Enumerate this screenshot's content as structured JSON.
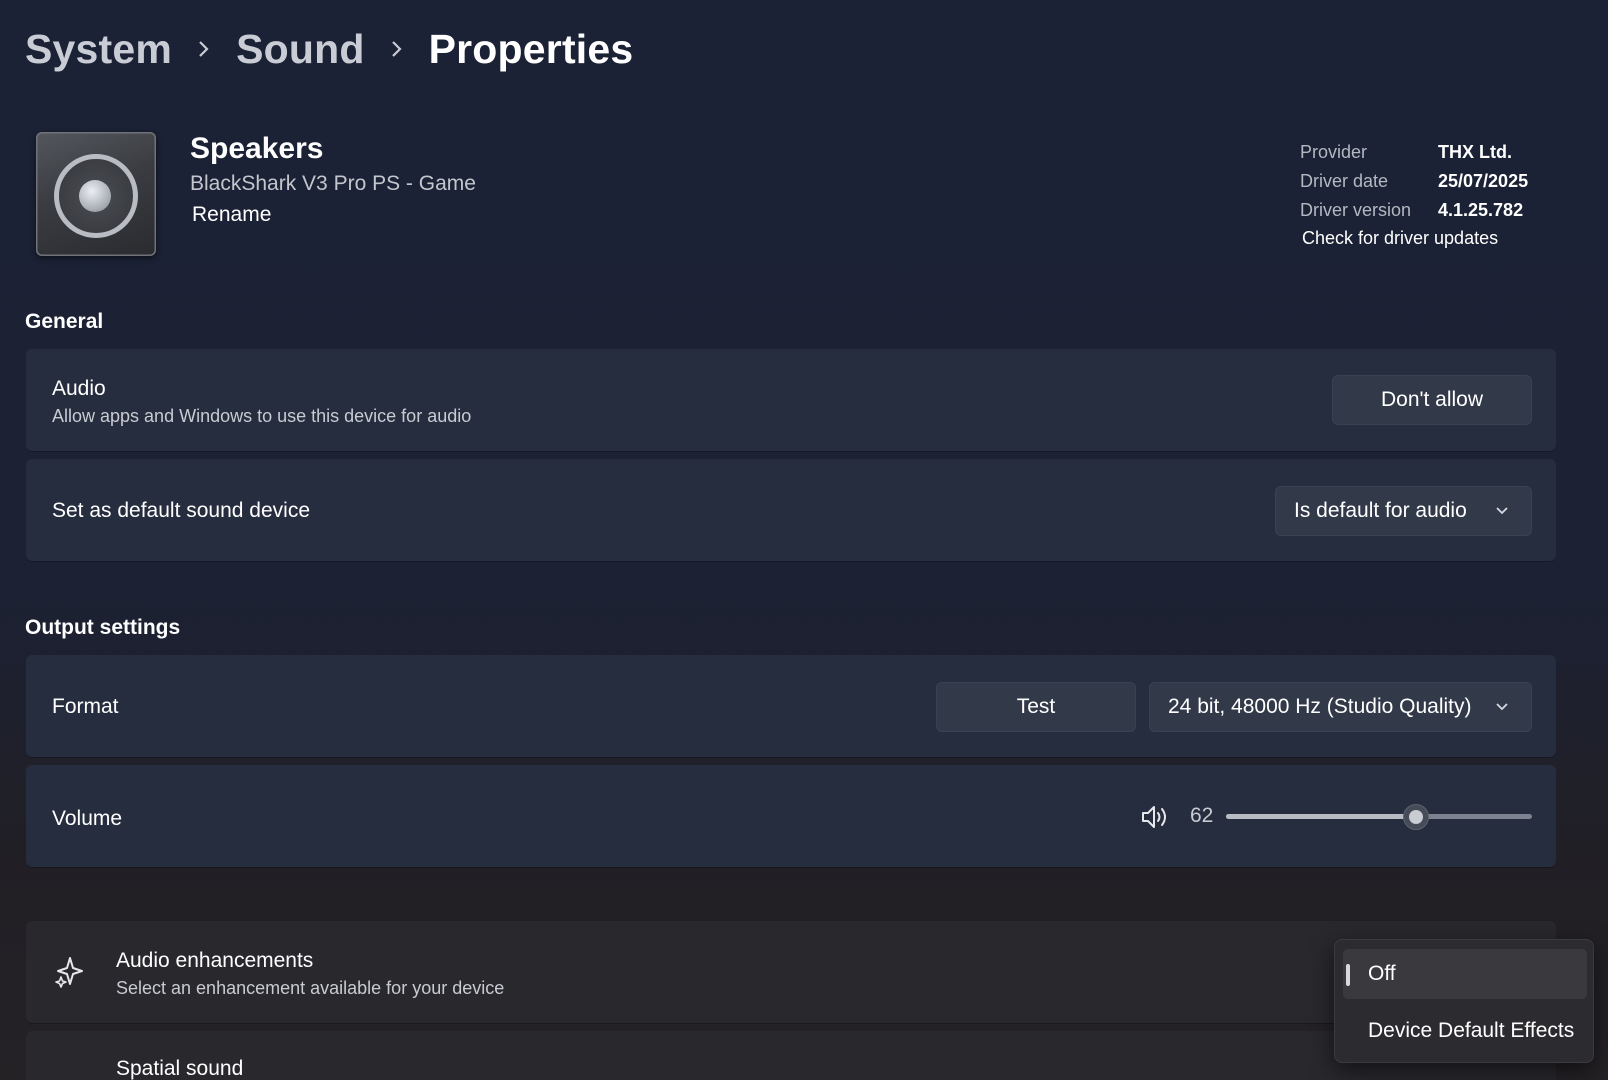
{
  "breadcrumb": {
    "items": [
      "System",
      "Sound",
      "Properties"
    ]
  },
  "device": {
    "name": "Speakers",
    "model": "BlackShark V3 Pro PS - Game",
    "rename_label": "Rename",
    "icon": "speaker-icon"
  },
  "driver_info": {
    "provider_label": "Provider",
    "provider_value": "THX Ltd.",
    "date_label": "Driver date",
    "date_value": "25/07/2025",
    "version_label": "Driver version",
    "version_value": "4.1.25.782",
    "update_link": "Check for driver updates"
  },
  "general": {
    "title": "General",
    "audio": {
      "label": "Audio",
      "description": "Allow apps and Windows to use this device for audio",
      "button": "Don't allow"
    },
    "default_device": {
      "label": "Set as default sound device",
      "selected": "Is default for audio"
    }
  },
  "output": {
    "title": "Output settings",
    "format": {
      "label": "Format",
      "test_button": "Test",
      "selected": "24 bit, 48000 Hz (Studio Quality)"
    },
    "volume": {
      "label": "Volume",
      "value": "62",
      "level": 62,
      "icon": "speaker-volume-icon"
    }
  },
  "enhancements": {
    "label": "Audio enhancements",
    "description": "Select an enhancement available for your device",
    "icon": "sparkle-icon",
    "options": [
      "Off",
      "Device Default Effects"
    ],
    "selected_index": 0
  },
  "spatial": {
    "label": "Spatial sound"
  },
  "colors": {
    "background": "#1c2133",
    "card": "#262d3e",
    "button": "#323949"
  }
}
